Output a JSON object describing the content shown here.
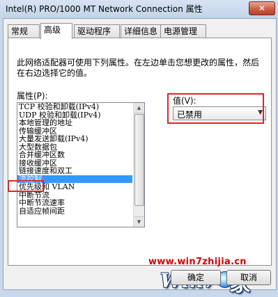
{
  "window": {
    "title": "Intel(R) PRO/1000 MT Network Connection 属性",
    "close_glyph": "✕"
  },
  "tabs": [
    {
      "label": "常规",
      "active": false
    },
    {
      "label": "高级",
      "active": true
    },
    {
      "label": "驱动程序",
      "active": false
    },
    {
      "label": "详细信息",
      "active": false
    },
    {
      "label": "电源管理",
      "active": false
    }
  ],
  "advanced": {
    "description": "此网络适配器可使用下列属性。在左边单击您想更改的属性，然后在右边选择它的值。",
    "property_label": "属性(P):",
    "value_label": "值(V):",
    "selected_value": "已禁用",
    "properties": [
      "TCP 校验和卸载(IPv4)",
      "UDP 校验和卸载(IPv4)",
      "本地管理的地址",
      "传输缓冲区",
      "大量发送卸载(IPv4)",
      "大型数据包",
      "合并缓冲区数",
      "接收缓冲区",
      "链接速度和双工",
      "流控制",
      "优先级和 VLAN",
      "中断节流",
      "中断节流速率",
      "自适应帧间距"
    ],
    "selected_property": "流控制"
  },
  "buttons": {
    "ok": "确定",
    "cancel": "取消"
  },
  "watermark": {
    "url": "www.win7zhijia.cn",
    "logo_text": "Win7",
    "logo_suffix": "家"
  },
  "icons": {
    "dropdown": "chevron-down-icon",
    "scroll_up": "scroll-up-arrow-icon",
    "scroll_down": "scroll-down-arrow-icon",
    "windows_orb": "windows-logo-icon"
  },
  "colors": {
    "highlight_box": "#e02424",
    "selection": "#3399ff",
    "watermark_text": "#d40000"
  }
}
